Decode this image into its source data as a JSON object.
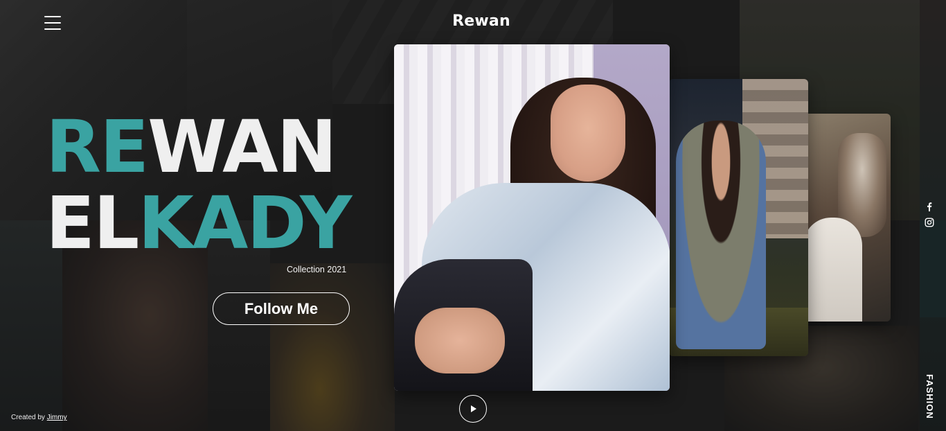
{
  "header": {
    "brand": "Rewan",
    "menu_icon": "hamburger-menu-icon"
  },
  "hero": {
    "line1_accent": "RE",
    "line1_rest": "WAN",
    "line2_start": "EL",
    "line2_accent": "KADY",
    "subtitle": "Collection 2021",
    "cta_label": "Follow Me"
  },
  "gallery": {
    "play_icon": "play-icon"
  },
  "social": {
    "items": [
      "facebook-icon",
      "instagram-icon"
    ]
  },
  "side_label": "FASHION",
  "footer": {
    "credit_prefix": "Created by",
    "credit_link": "Jimmy"
  },
  "colors": {
    "accent": "#3aa3a2",
    "background": "#1b1b1b",
    "text": "#ffffff"
  }
}
